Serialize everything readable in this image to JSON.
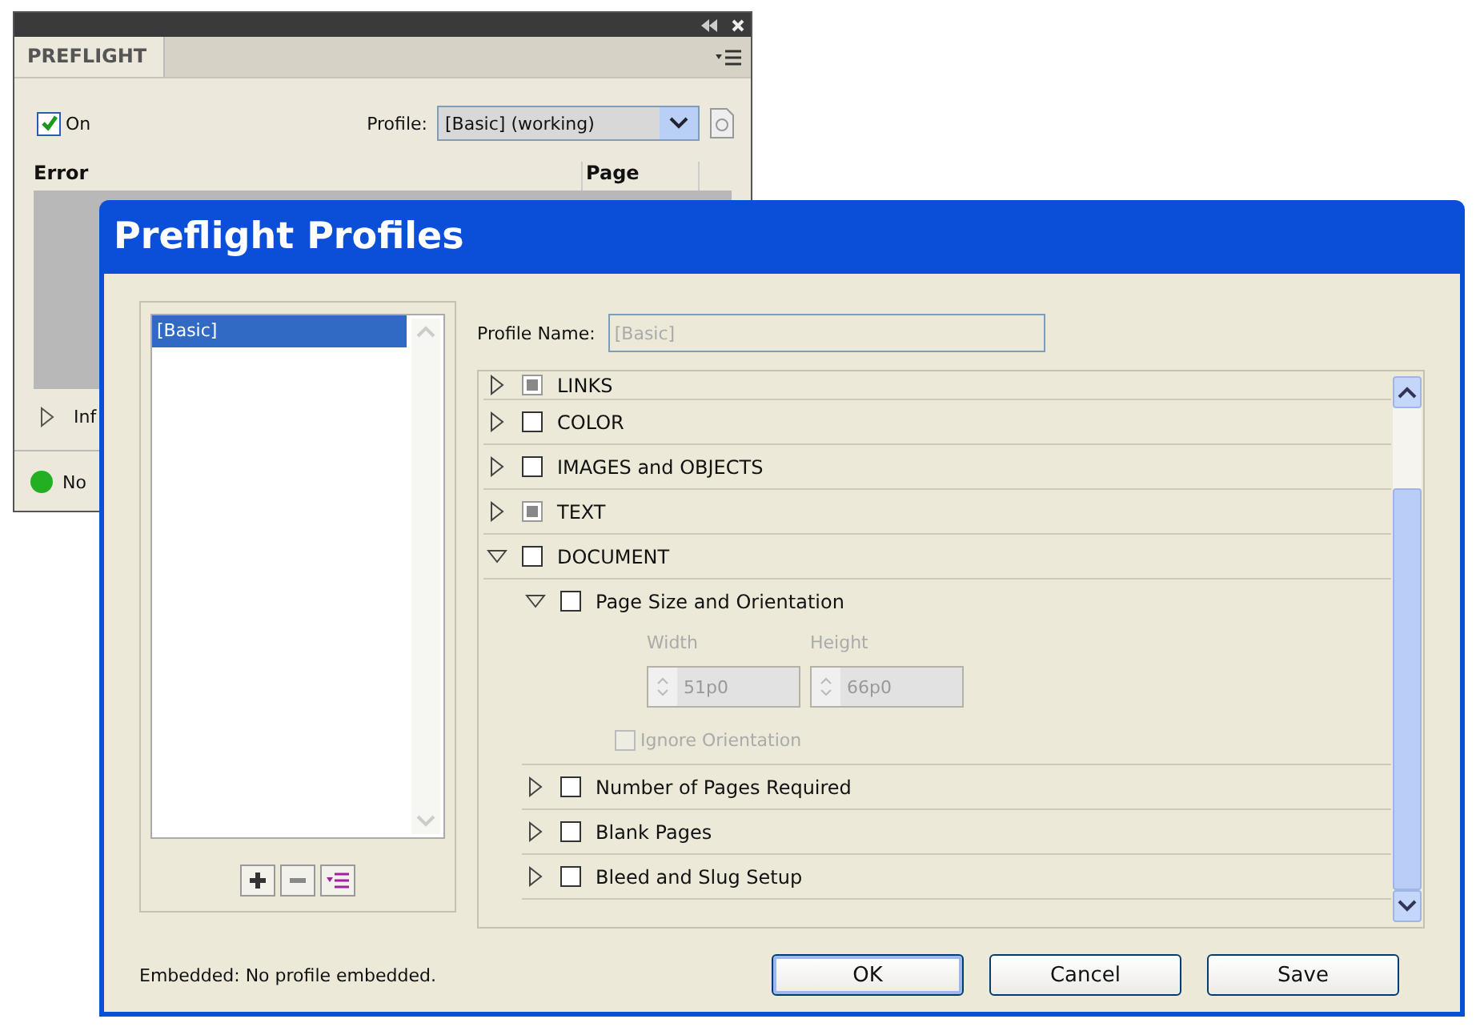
{
  "panel": {
    "tab": "PREFLIGHT",
    "on": {
      "label": "On",
      "checked": true
    },
    "profile_label": "Profile:",
    "profile_value": "[Basic] (working)",
    "columns": [
      "Error",
      "Page"
    ],
    "info_label": "Inf",
    "status": "No"
  },
  "dialog": {
    "title": "Preflight Profiles",
    "profiles": [
      {
        "label": "[Basic]",
        "selected": true
      }
    ],
    "profile_name_label": "Profile Name:",
    "profile_name": {
      "value": "[Basic]",
      "disabled": true
    },
    "categories": [
      {
        "name": "LINKS",
        "checked": false,
        "mixed": true,
        "expanded": false
      },
      {
        "name": "COLOR",
        "checked": false,
        "mixed": false,
        "expanded": false
      },
      {
        "name": "IMAGES and OBJECTS",
        "checked": false,
        "mixed": false,
        "expanded": false
      },
      {
        "name": "TEXT",
        "checked": false,
        "mixed": true,
        "expanded": false
      },
      {
        "name": "DOCUMENT",
        "checked": false,
        "mixed": false,
        "expanded": true,
        "children": [
          {
            "name": "Page Size and Orientation",
            "checked": false,
            "expanded": true,
            "fields": [
              {
                "label": "Width",
                "value": "51p0",
                "disabled": true
              },
              {
                "label": "Height",
                "value": "66p0",
                "disabled": true
              }
            ],
            "option": {
              "label": "Ignore Orientation",
              "checked": false,
              "disabled": true
            }
          },
          {
            "name": "Number of Pages Required",
            "checked": false,
            "expanded": false
          },
          {
            "name": "Blank Pages",
            "checked": false,
            "expanded": false
          },
          {
            "name": "Bleed and Slug Setup",
            "checked": false,
            "expanded": false
          }
        ]
      }
    ],
    "embedded": "Embedded: No profile embedded.",
    "buttons": [
      {
        "label": "OK",
        "default": true
      },
      {
        "label": "Cancel",
        "default": false
      },
      {
        "label": "Save",
        "default": false
      }
    ]
  }
}
